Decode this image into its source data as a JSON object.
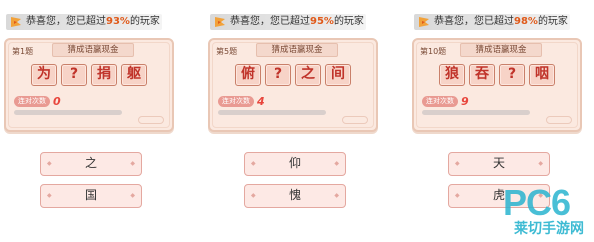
{
  "panels": [
    {
      "banner_prefix": "恭喜您，您已超过",
      "banner_highlight": "93%",
      "banner_suffix": "的玩家",
      "level": "第1题",
      "title": "猜成语赢现金",
      "slots": [
        "为",
        "?",
        "捐",
        "躯"
      ],
      "streak_label": "连对次数",
      "streak_value": "0",
      "progress": 0,
      "answers": [
        "之",
        "国"
      ]
    },
    {
      "banner_prefix": "恭喜您，您已超过",
      "banner_highlight": "95%",
      "banner_suffix": "的玩家",
      "level": "第5题",
      "title": "猜成语赢现金",
      "slots": [
        "俯",
        "?",
        "之",
        "间"
      ],
      "streak_label": "连对次数",
      "streak_value": "4",
      "progress": 0,
      "answers": [
        "仰",
        "愧"
      ]
    },
    {
      "banner_prefix": "恭喜您，您已超过",
      "banner_highlight": "98%",
      "banner_suffix": "的玩家",
      "level": "第10题",
      "title": "猜成语赢现金",
      "slots": [
        "狼",
        "吞",
        "?",
        "咽"
      ],
      "streak_label": "连对次数",
      "streak_value": "9",
      "progress": 0,
      "answers": [
        "天",
        "虎"
      ]
    }
  ],
  "watermark": {
    "logo": "PC6",
    "text": "莱切手游网"
  },
  "colors": {
    "accent": "#e8453c",
    "card_bg": "#fbe9e0",
    "watermark": "#2ab4cf"
  }
}
